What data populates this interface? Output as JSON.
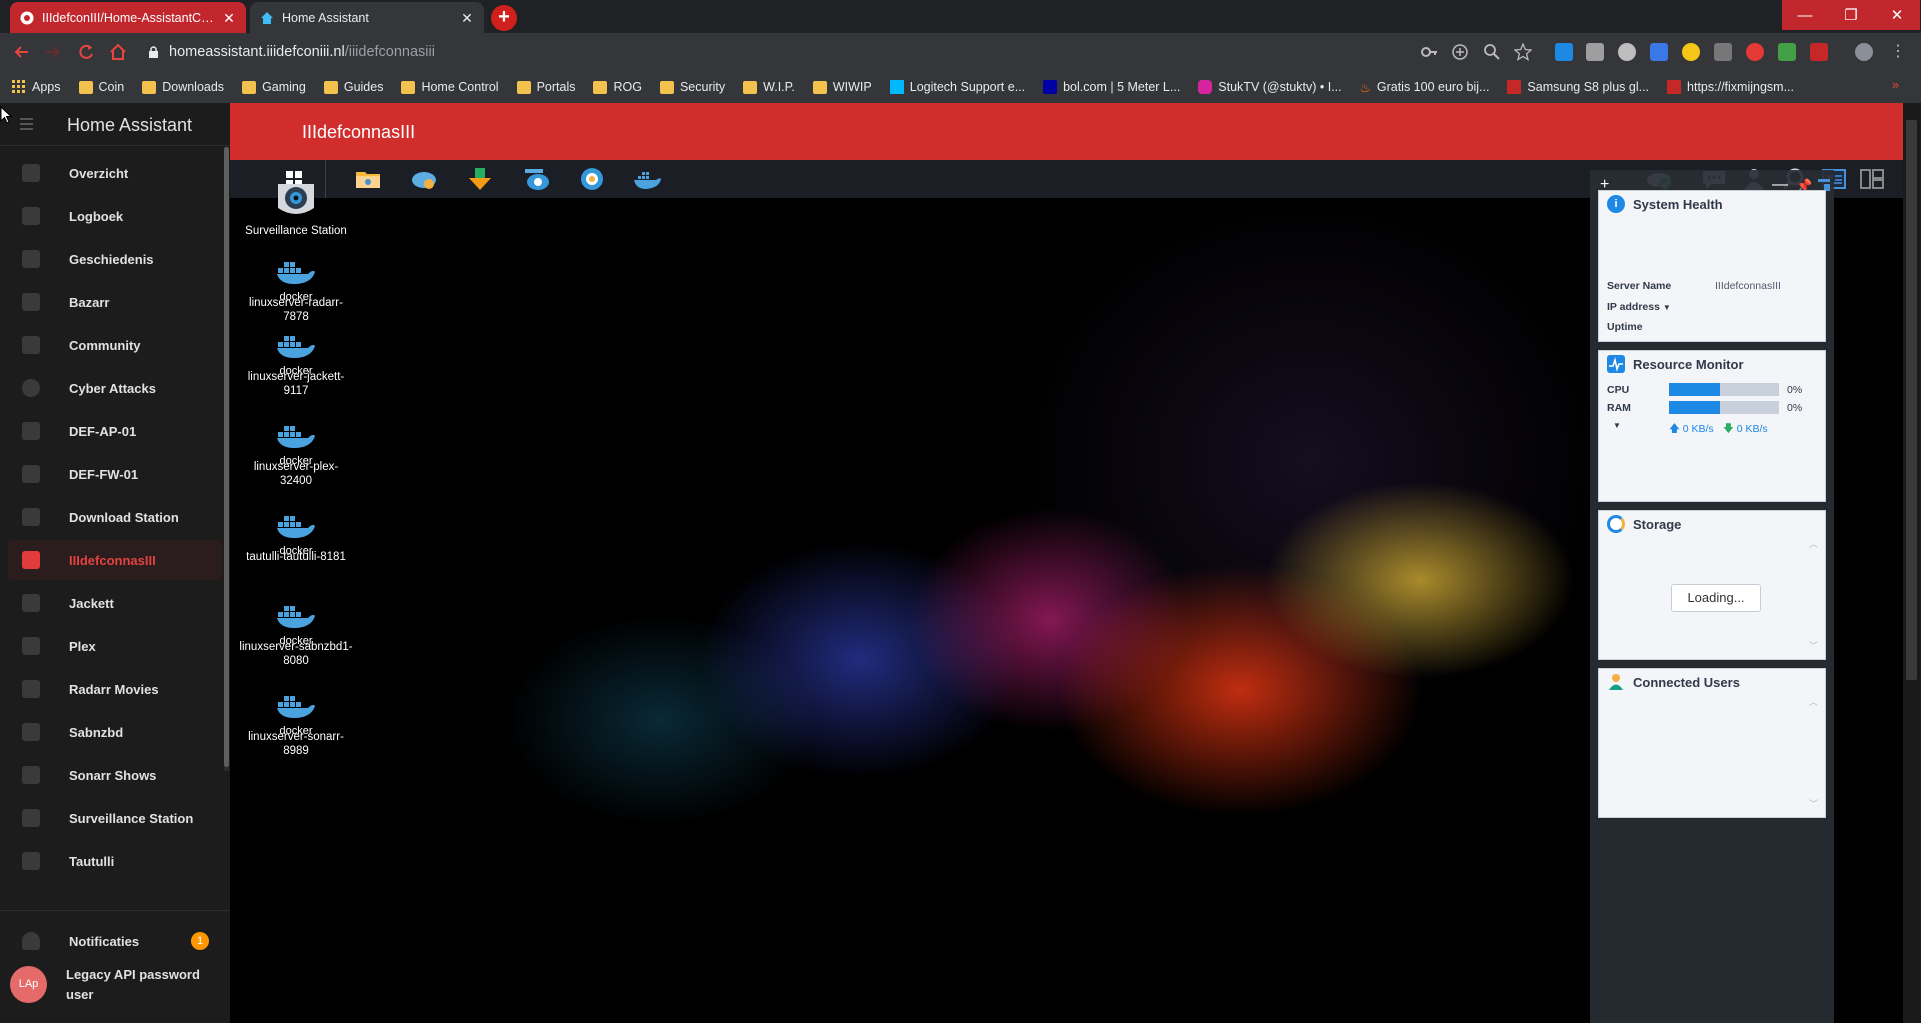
{
  "browser": {
    "tabs": [
      {
        "title": "IIIdefconIII/Home-AssistantConfig",
        "active": false
      },
      {
        "title": "Home Assistant",
        "active": true
      }
    ],
    "url": {
      "host": "homeassistant.iiidefconiii.nl",
      "path": "/iiidefconnasiii"
    },
    "bookmarks": [
      "Apps",
      "Coin",
      "Downloads",
      "Gaming",
      "Guides",
      "Home Control",
      "Portals",
      "ROG",
      "Security",
      "W.I.P.",
      "WIWIP",
      "Logitech Support e...",
      "bol.com | 5 Meter L...",
      "StukTV (@stuktv) • I...",
      "Gratis 100 euro bij...",
      "Samsung S8 plus gl...",
      "https://fixmijngsm..."
    ],
    "bookmarks_overflow": "»"
  },
  "sidebar": {
    "title": "Home Assistant",
    "items": [
      {
        "label": "Overzicht",
        "icon": "dashboard-icon"
      },
      {
        "label": "Logboek",
        "icon": "list-icon"
      },
      {
        "label": "Geschiedenis",
        "icon": "chart-icon"
      },
      {
        "label": "Bazarr",
        "icon": "bazarr-icon"
      },
      {
        "label": "Community",
        "icon": "community-icon"
      },
      {
        "label": "Cyber Attacks",
        "icon": "globe-icon"
      },
      {
        "label": "DEF-AP-01",
        "icon": "router-icon"
      },
      {
        "label": "DEF-FW-01",
        "icon": "router-icon"
      },
      {
        "label": "Download Station",
        "icon": "download-icon"
      },
      {
        "label": "IIIdefconnasIII",
        "icon": "nas-icon",
        "selected": true
      },
      {
        "label": "Jackett",
        "icon": "jackett-icon"
      },
      {
        "label": "Plex",
        "icon": "plex-icon"
      },
      {
        "label": "Radarr Movies",
        "icon": "movie-icon"
      },
      {
        "label": "Sabnzbd",
        "icon": "sabnzbd-icon"
      },
      {
        "label": "Sonarr Shows",
        "icon": "tv-icon"
      },
      {
        "label": "Surveillance Station",
        "icon": "camera-icon"
      },
      {
        "label": "Tautulli",
        "icon": "tautulli-icon"
      }
    ],
    "notifications": {
      "label": "Notificaties",
      "count": "1"
    },
    "user": {
      "initials": "LAp",
      "name": "Legacy API password user"
    }
  },
  "header": {
    "title": "IIIdefconnasIII"
  },
  "desktop_icons": [
    {
      "label": "Surveillance Station",
      "icon": "surveillance-icon"
    },
    {
      "label": "linuxserver-radarr-7878",
      "icon": "docker-icon"
    },
    {
      "label": "linuxserver-jackett-9117",
      "icon": "docker-icon"
    },
    {
      "label": "linuxserver-plex-32400",
      "icon": "docker-icon"
    },
    {
      "label": "tautulli-tautulli-8181",
      "icon": "docker-icon"
    },
    {
      "label": "linuxserver-sabnzbd1-8080",
      "icon": "docker-icon"
    },
    {
      "label": "linuxserver-sonarr-8989",
      "icon": "docker-icon"
    }
  ],
  "docker_word": "docker",
  "widgets": {
    "system_health": {
      "title": "System Health",
      "server_name_label": "Server Name",
      "server_name_value": "IIIdefconnasIII",
      "ip_label": "IP address",
      "uptime_label": "Uptime"
    },
    "resource_monitor": {
      "title": "Resource Monitor",
      "cpu_label": "CPU",
      "cpu_value": "0%",
      "cpu_fill_percent": 46,
      "ram_label": "RAM",
      "ram_value": "0%",
      "ram_fill_percent": 46,
      "upload": "0 KB/s",
      "download": "0 KB/s"
    },
    "storage": {
      "title": "Storage",
      "loading": "Loading..."
    },
    "connected_users": {
      "title": "Connected Users"
    }
  },
  "colors": {
    "ha_red": "#d12d2d",
    "accent_blue": "#1e88e5",
    "badge_orange": "#ff9800"
  }
}
